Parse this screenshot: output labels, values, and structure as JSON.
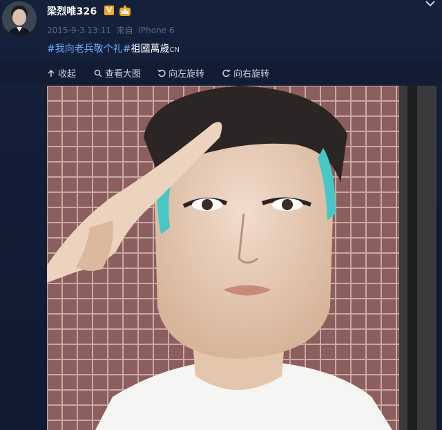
{
  "user": {
    "name": "梁烈唯326",
    "verified_badge": "V",
    "avatar_icon": "avatar",
    "crown_icon": "crown-icon"
  },
  "meta": {
    "date": "2015-9-3 13:11",
    "from_label": "来自",
    "device": "iPhone 6"
  },
  "post": {
    "hashtag": "#我向老兵敬个礼#",
    "text": "祖國萬歲",
    "suffix": "CN"
  },
  "toolbar": {
    "collapse": "收起",
    "view_large": "查看大图",
    "rotate_left": "向左旋转",
    "rotate_right": "向右旋转"
  },
  "colors": {
    "background": "#10192b",
    "hashtag": "#6ea8ff",
    "badge": "#f5a623",
    "meta": "#5b6782"
  }
}
